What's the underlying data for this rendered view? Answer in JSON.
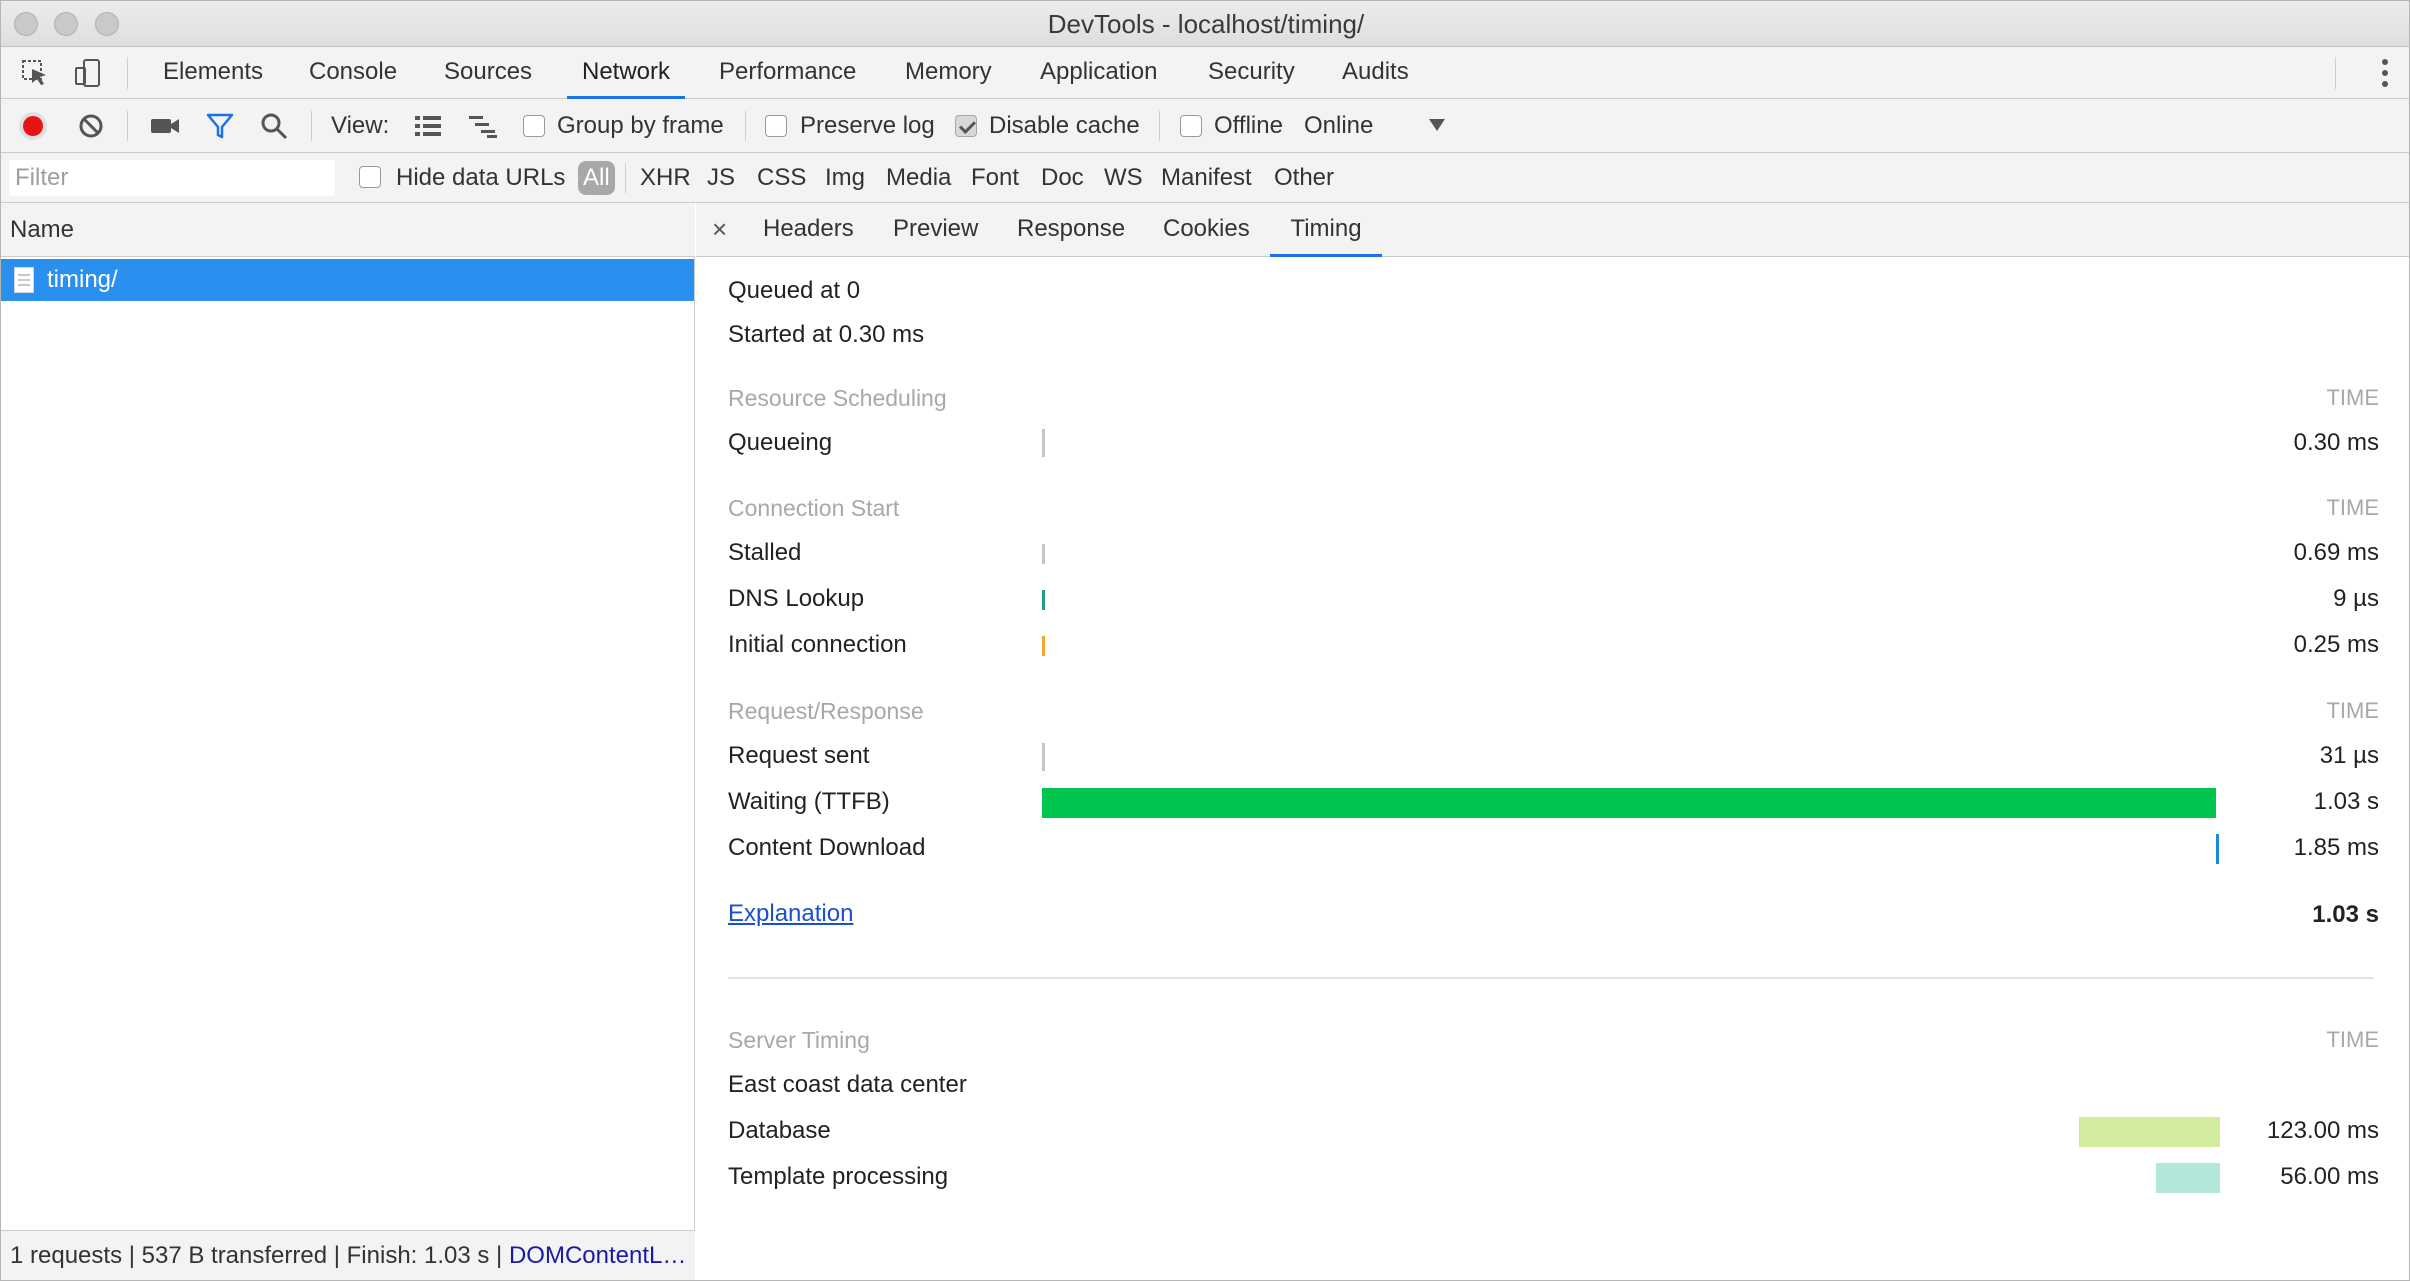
{
  "window": {
    "title": "DevTools - localhost/timing/"
  },
  "main_tabs": [
    {
      "label": "Elements"
    },
    {
      "label": "Console"
    },
    {
      "label": "Sources"
    },
    {
      "label": "Network",
      "active": true
    },
    {
      "label": "Performance"
    },
    {
      "label": "Memory"
    },
    {
      "label": "Application"
    },
    {
      "label": "Security"
    },
    {
      "label": "Audits"
    }
  ],
  "toolbar": {
    "view_label": "View:",
    "group_by_frame": {
      "label": "Group by frame",
      "checked": false
    },
    "preserve_log": {
      "label": "Preserve log",
      "checked": false
    },
    "disable_cache": {
      "label": "Disable cache",
      "checked": true
    },
    "offline": {
      "label": "Offline",
      "checked": false
    },
    "throttling": {
      "value": "Online"
    }
  },
  "filter_bar": {
    "placeholder": "Filter",
    "hide_data_urls": {
      "label": "Hide data URLs",
      "checked": false
    },
    "types": [
      "All",
      "XHR",
      "JS",
      "CSS",
      "Img",
      "Media",
      "Font",
      "Doc",
      "WS",
      "Manifest",
      "Other"
    ],
    "active_type": "All"
  },
  "request_list": {
    "column_header": "Name",
    "rows": [
      {
        "name": "timing/",
        "selected": true
      }
    ]
  },
  "status_bar": {
    "summary": "1 requests | 537 B transferred | Finish: 1.03 s | ",
    "dom_content_loaded": "DOMContentL…"
  },
  "detail_tabs": {
    "close": "×",
    "tabs": [
      {
        "label": "Headers"
      },
      {
        "label": "Preview"
      },
      {
        "label": "Response"
      },
      {
        "label": "Cookies"
      },
      {
        "label": "Timing",
        "active": true
      }
    ]
  },
  "timing": {
    "queued": "Queued at 0",
    "started": "Started at 0.30 ms",
    "time_header": "TIME",
    "sections": {
      "scheduling": {
        "title": "Resource Scheduling",
        "rows": [
          {
            "label": "Queueing",
            "time": "0.30 ms",
            "bar_start": 0.0,
            "bar_fraction": 0.0003,
            "color": "#c5c5c5"
          }
        ]
      },
      "connection": {
        "title": "Connection Start",
        "rows": [
          {
            "label": "Stalled",
            "time": "0.69 ms",
            "bar_start": 0.0,
            "bar_fraction": 0.0007,
            "color": "#c5c5c5"
          },
          {
            "label": "DNS Lookup",
            "time": "9 µs",
            "bar_start": 0.0,
            "bar_fraction": 1e-05,
            "color": "#1f9e8f"
          },
          {
            "label": "Initial connection",
            "time": "0.25 ms",
            "bar_start": 0.0,
            "bar_fraction": 0.0002,
            "color": "#f2a531"
          }
        ]
      },
      "request": {
        "title": "Request/Response",
        "rows": [
          {
            "label": "Request sent",
            "time": "31 µs",
            "bar_start": 0.0,
            "bar_fraction": 3e-05,
            "color": "#c5c5c5"
          },
          {
            "label": "Waiting (TTFB)",
            "time": "1.03 s",
            "bar_start": 0.0,
            "bar_fraction": 0.998,
            "color": "#00c650"
          },
          {
            "label": "Content Download",
            "time": "1.85 ms",
            "bar_start": 0.998,
            "bar_fraction": 0.0018,
            "color": "#1a8ad6"
          }
        ]
      }
    },
    "explanation": {
      "label": "Explanation",
      "total": "1.03 s"
    },
    "server_timing": {
      "title": "Server Timing",
      "rows": [
        {
          "label": "East coast data center",
          "time": ""
        },
        {
          "label": "Database",
          "time": "123.00 ms",
          "value_ms": 123.0,
          "color": "#d2ec9e"
        },
        {
          "label": "Template processing",
          "time": "56.00 ms",
          "value_ms": 56.0,
          "color": "#b2e7d9"
        }
      ]
    }
  }
}
